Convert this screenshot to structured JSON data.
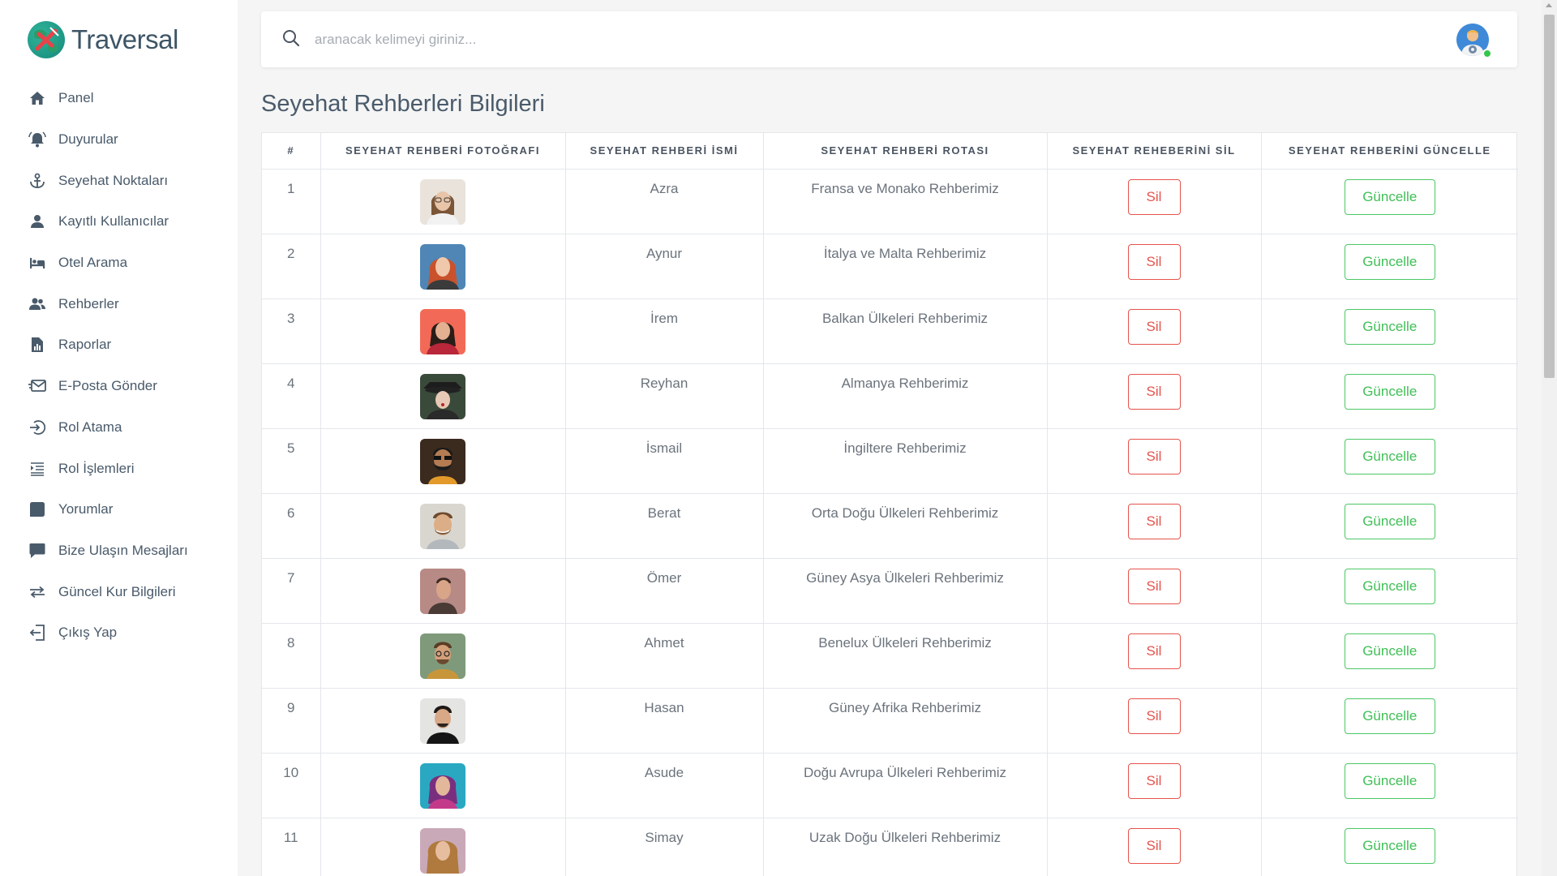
{
  "brand": {
    "name": "Traversal"
  },
  "sidebar": {
    "items": [
      {
        "label": "Panel",
        "icon": "home-icon"
      },
      {
        "label": "Duyurular",
        "icon": "bell-icon"
      },
      {
        "label": "Seyehat Noktaları",
        "icon": "anchor-icon"
      },
      {
        "label": "Kayıtlı Kullanıcılar",
        "icon": "user-icon"
      },
      {
        "label": "Otel Arama",
        "icon": "bed-icon"
      },
      {
        "label": "Rehberler",
        "icon": "users-icon"
      },
      {
        "label": "Raporlar",
        "icon": "report-icon"
      },
      {
        "label": "E-Posta Gönder",
        "icon": "mail-send-icon"
      },
      {
        "label": "Rol Atama",
        "icon": "login-icon"
      },
      {
        "label": "Rol İşlemleri",
        "icon": "list-indent-icon"
      },
      {
        "label": "Yorumlar",
        "icon": "comment-icon"
      },
      {
        "label": "Bize Ulaşın Mesajları",
        "icon": "message-icon"
      },
      {
        "label": "Güncel Kur Bilgileri",
        "icon": "exchange-icon"
      },
      {
        "label": "Çıkış Yap",
        "icon": "logout-icon"
      }
    ]
  },
  "search": {
    "placeholder": "aranacak kelimeyi giriniz..."
  },
  "page": {
    "title": "Seyehat Rehberleri Bilgileri"
  },
  "table": {
    "headers": [
      "#",
      "SEYEHAT REHBERİ FOTOĞRAFI",
      "SEYEHAT REHBERİ İSMİ",
      "SEYEHAT REHBERİ ROTASI",
      "SEYEHAT REHEBERİNİ SİL",
      "SEYEHAT REHBERİNİ GÜNCELLE"
    ],
    "delete_label": "Sil",
    "update_label": "Güncelle",
    "rows": [
      {
        "id": "1",
        "name": "Azra",
        "route": "Fransa ve Monako Rehberimiz"
      },
      {
        "id": "2",
        "name": "Aynur",
        "route": "İtalya ve Malta Rehberimiz"
      },
      {
        "id": "3",
        "name": "İrem",
        "route": "Balkan Ülkeleri Rehberimiz"
      },
      {
        "id": "4",
        "name": "Reyhan",
        "route": "Almanya Rehberimiz"
      },
      {
        "id": "5",
        "name": "İsmail",
        "route": "İngiltere Rehberimiz"
      },
      {
        "id": "6",
        "name": "Berat",
        "route": "Orta Doğu Ülkeleri Rehberimiz"
      },
      {
        "id": "7",
        "name": "Ömer",
        "route": "Güney Asya Ülkeleri Rehberimiz"
      },
      {
        "id": "8",
        "name": "Ahmet",
        "route": "Benelux Ülkeleri Rehberimiz"
      },
      {
        "id": "9",
        "name": "Hasan",
        "route": "Güney Afrika Rehberimiz"
      },
      {
        "id": "10",
        "name": "Asude",
        "route": "Doğu Avrupa Ülkeleri Rehberimiz"
      },
      {
        "id": "11",
        "name": "Simay",
        "route": "Uzak Doğu Ülkeleri Rehberimiz"
      }
    ]
  },
  "colors": {
    "delete": "#e5534b",
    "update": "#3fbf56",
    "brand": "#3d5566"
  }
}
